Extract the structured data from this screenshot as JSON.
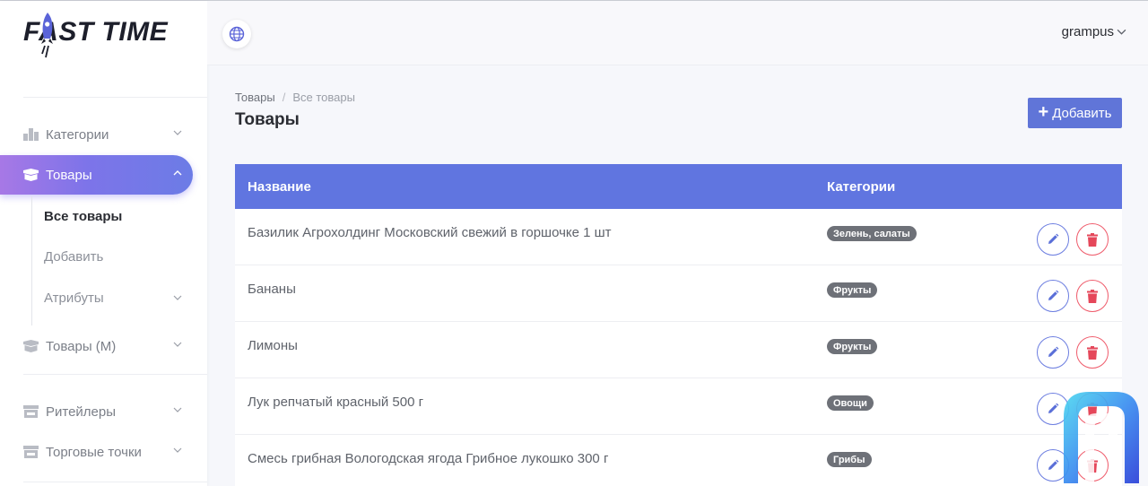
{
  "brand": {
    "logo_text": "FAST TIME"
  },
  "sidebar": {
    "items": [
      {
        "label": "Категории",
        "icon": "categories-icon",
        "expandable": true
      },
      {
        "label": "Товары",
        "icon": "box-icon",
        "expandable": true,
        "active": true
      },
      {
        "label": "Товары (М)",
        "icon": "box-icon",
        "expandable": true
      },
      {
        "label": "Ритейлеры",
        "icon": "store-icon",
        "expandable": true
      },
      {
        "label": "Торговые точки",
        "icon": "store-icon",
        "expandable": true
      }
    ],
    "subitems": [
      {
        "label": "Все товары",
        "active": true
      },
      {
        "label": "Добавить"
      },
      {
        "label": "Атрибуты",
        "expandable": true
      }
    ]
  },
  "topbar": {
    "language_icon": "globe-icon",
    "user_name": "grampus"
  },
  "breadcrumb": {
    "root": "Товары",
    "separator": "/",
    "current": "Все товары"
  },
  "page": {
    "title": "Товары",
    "add_label": "Добавить"
  },
  "table": {
    "headers": {
      "name": "Название",
      "categories": "Категории"
    },
    "rows": [
      {
        "name": "Базилик Агрохолдинг Московский свежий в горшочке 1 шт",
        "category": "Зелень, салаты"
      },
      {
        "name": "Бананы",
        "category": "Фрукты"
      },
      {
        "name": "Лимоны",
        "category": "Фрукты"
      },
      {
        "name": "Лук репчатый красный 500 г",
        "category": "Овощи"
      },
      {
        "name": "Смесь грибная Вологодская ягода Грибное лукошко 300 г",
        "category": "Грибы"
      }
    ]
  },
  "colors": {
    "accent": "#6075e0",
    "active_gradient_start": "#a778e6",
    "active_gradient_end": "#6c7ce6",
    "delete": "#ef5b6b",
    "badge": "#6e7178"
  }
}
